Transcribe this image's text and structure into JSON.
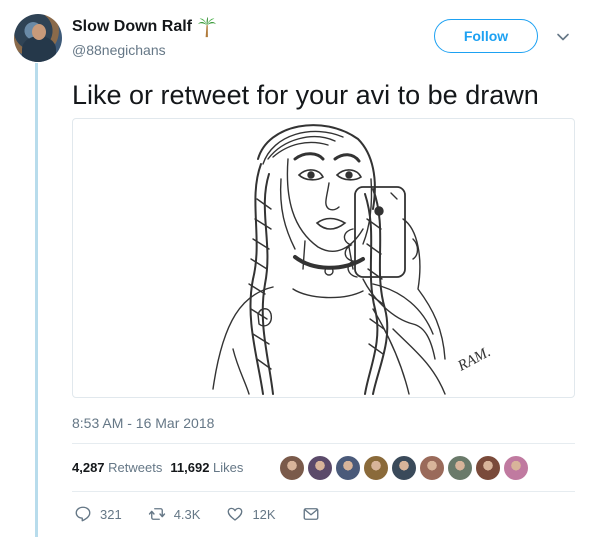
{
  "user": {
    "display_name": "Slow Down Ralf",
    "handle": "@88negichans",
    "name_emoji_icon": "palm-tree-icon"
  },
  "header": {
    "follow_label": "Follow",
    "menu_icon": "chevron-down-icon"
  },
  "tweet": {
    "text": "Like or retweet for your avi to be drawn",
    "media_signature": "RAM.",
    "timestamp": "8:53 AM - 16 Mar 2018"
  },
  "stats": {
    "retweets_count": "4,287",
    "retweets_label": "Retweets",
    "likes_count": "11,692",
    "likes_label": "Likes"
  },
  "likers": [
    "#7a5a4a",
    "#5b4a6a",
    "#4a5a7a",
    "#8a6a3a",
    "#3a4a5a",
    "#9a6a5a",
    "#6a7a6a",
    "#7a4a3a",
    "#c07aa0"
  ],
  "actions": {
    "reply_count": "321",
    "retweet_count": "4.3K",
    "like_count": "12K"
  },
  "colors": {
    "accent": "#1da1f2",
    "secondary_text": "#657786",
    "thread_line": "#b8dcec"
  }
}
